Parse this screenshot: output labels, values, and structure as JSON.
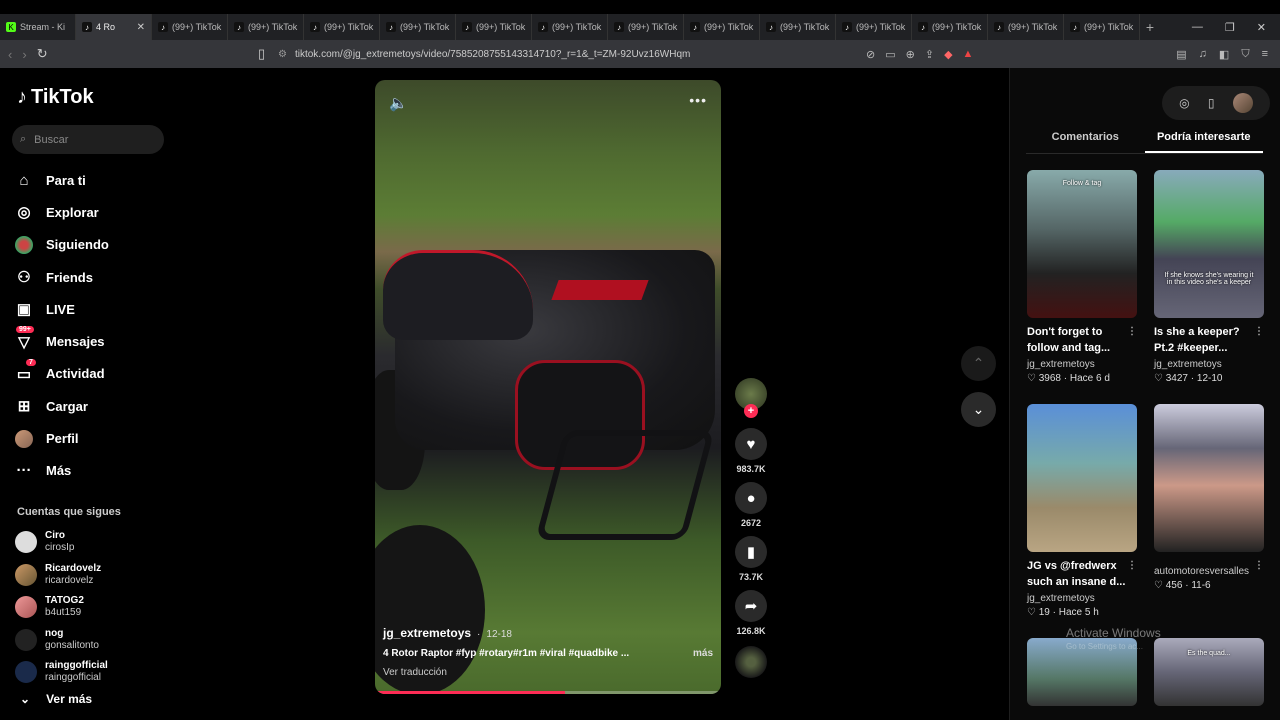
{
  "browser": {
    "tabs": [
      {
        "label": "Stream - Ki",
        "icon": "kick-icon",
        "active": false
      },
      {
        "label": "4 Ro",
        "icon": "tiktok-icon",
        "active": true
      },
      {
        "label": "(99+) TikTok",
        "icon": "tiktok-icon",
        "active": false
      },
      {
        "label": "(99+) TikTok",
        "icon": "tiktok-icon",
        "active": false
      },
      {
        "label": "(99+) TikTok",
        "icon": "tiktok-icon",
        "active": false
      },
      {
        "label": "(99+) TikTok",
        "icon": "tiktok-icon",
        "active": false
      },
      {
        "label": "(99+) TikTok",
        "icon": "tiktok-icon",
        "active": false
      },
      {
        "label": "(99+) TikTok",
        "icon": "tiktok-icon",
        "active": false
      },
      {
        "label": "(99+) TikTok",
        "icon": "tiktok-icon",
        "active": false
      },
      {
        "label": "(99+) TikTok",
        "icon": "tiktok-icon",
        "active": false
      },
      {
        "label": "(99+) TikTok",
        "icon": "tiktok-icon",
        "active": false
      },
      {
        "label": "(99+) TikTok",
        "icon": "tiktok-icon",
        "active": false
      },
      {
        "label": "(99+) TikTok",
        "icon": "tiktok-icon",
        "active": false
      },
      {
        "label": "(99+) TikTok",
        "icon": "tiktok-icon",
        "active": false
      },
      {
        "label": "(99+) TikTok",
        "icon": "tiktok-icon",
        "active": false
      }
    ],
    "url": "tiktok.com/@jg_extremetoys/video/7585208755143314710?_r=1&_t=ZM-92Uvz16WHqm"
  },
  "sidebar": {
    "logo": "TikTok",
    "search_placeholder": "Buscar",
    "menu": [
      {
        "label": "Para ti",
        "icon": "home-icon"
      },
      {
        "label": "Explorar",
        "icon": "compass-icon"
      },
      {
        "label": "Siguiendo",
        "icon": "following-avatar-icon"
      },
      {
        "label": "Friends",
        "icon": "friends-icon"
      },
      {
        "label": "LIVE",
        "icon": "live-icon"
      },
      {
        "label": "Mensajes",
        "icon": "messages-icon",
        "badge": "99+"
      },
      {
        "label": "Actividad",
        "icon": "activity-icon",
        "badge": "7"
      },
      {
        "label": "Cargar",
        "icon": "upload-icon"
      },
      {
        "label": "Perfil",
        "icon": "profile-avatar-icon"
      },
      {
        "label": "Más",
        "icon": "more-icon"
      }
    ],
    "following_title": "Cuentas que sigues",
    "following": [
      {
        "name": "Ciro",
        "handle": "cirosIp"
      },
      {
        "name": "Ricardovelz",
        "handle": "ricardovelz"
      },
      {
        "name": "TATOG2",
        "handle": "b4ut159"
      },
      {
        "name": "nog",
        "handle": "gonsalitonto"
      },
      {
        "name": "rainggofficial",
        "handle": "rainggofficial"
      }
    ],
    "see_more": "Ver más"
  },
  "video": {
    "author": "jg_extremetoys",
    "date": "12-18",
    "description": "4 Rotor Raptor #fyp #rotary#r1m #viral #quadbike ...",
    "more": "más",
    "translate": "Ver traducción",
    "progress": 0.55,
    "likes": "983.7K",
    "comments": "2672",
    "saves": "73.7K",
    "shares": "126.8K"
  },
  "right_panel": {
    "tabs": [
      "Comentarios",
      "Podría interesarte"
    ],
    "active_tab": 1,
    "cards": [
      {
        "title": "Don't forget to follow and tag...",
        "user": "jg_extremetoys",
        "likes": "3968",
        "age": "Hace 6 d",
        "caption": "Follow & tag"
      },
      {
        "title": "Is she a keeper? Pt.2 #keeper...",
        "user": "jg_extremetoys",
        "likes": "3427",
        "age": "12-10",
        "caption": "If she knows she's wearing it in this video she's a keeper"
      },
      {
        "title": "JG vs @fredwerx such an insane d...",
        "user": "jg_extremetoys",
        "likes": "19",
        "age": "Hace 5 h",
        "caption": ""
      },
      {
        "title": "",
        "user": "automotoresversalles",
        "likes": "456",
        "age": "11-6",
        "caption": ""
      },
      {
        "title": "",
        "user": "",
        "likes": "",
        "age": "",
        "caption": ""
      },
      {
        "title": "",
        "user": "",
        "likes": "",
        "age": "",
        "caption": "Es the quad..."
      }
    ]
  },
  "watermark": {
    "line1": "Activate Windows",
    "line2": "Go to Settings to ac..."
  }
}
